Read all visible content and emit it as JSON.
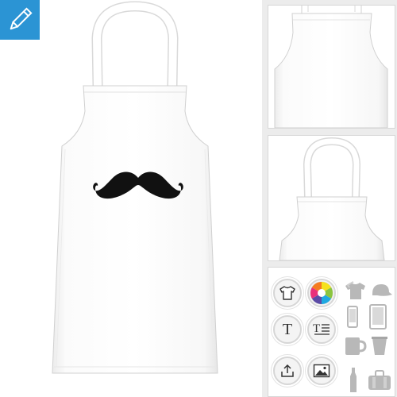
{
  "product": {
    "name": "apron",
    "design": "mustache-icon",
    "apron_color": "#ffffff",
    "design_color": "#111111"
  },
  "views": [
    {
      "name": "front-full",
      "active": true
    },
    {
      "name": "back-top",
      "active": false
    },
    {
      "name": "front-top",
      "active": false
    }
  ],
  "toolbar": {
    "edit": {
      "icon": "pencil-icon",
      "color": "#2b94d4"
    },
    "tools": [
      {
        "icon": "tshirt-icon"
      },
      {
        "icon": "color-wheel-icon"
      },
      {
        "icon": "text-icon",
        "glyph": "T"
      },
      {
        "icon": "text-lines-icon",
        "glyph": "T"
      },
      {
        "icon": "upload-icon"
      },
      {
        "icon": "image-icon"
      }
    ],
    "categories": [
      {
        "icon": "clothing-icon"
      },
      {
        "icon": "cap-icon"
      },
      {
        "icon": "phone-case-icon"
      },
      {
        "icon": "tablet-case-icon"
      },
      {
        "icon": "mug-icon"
      },
      {
        "icon": "cup-icon"
      },
      {
        "icon": "bottle-icon"
      },
      {
        "icon": "bag-icon"
      }
    ]
  }
}
